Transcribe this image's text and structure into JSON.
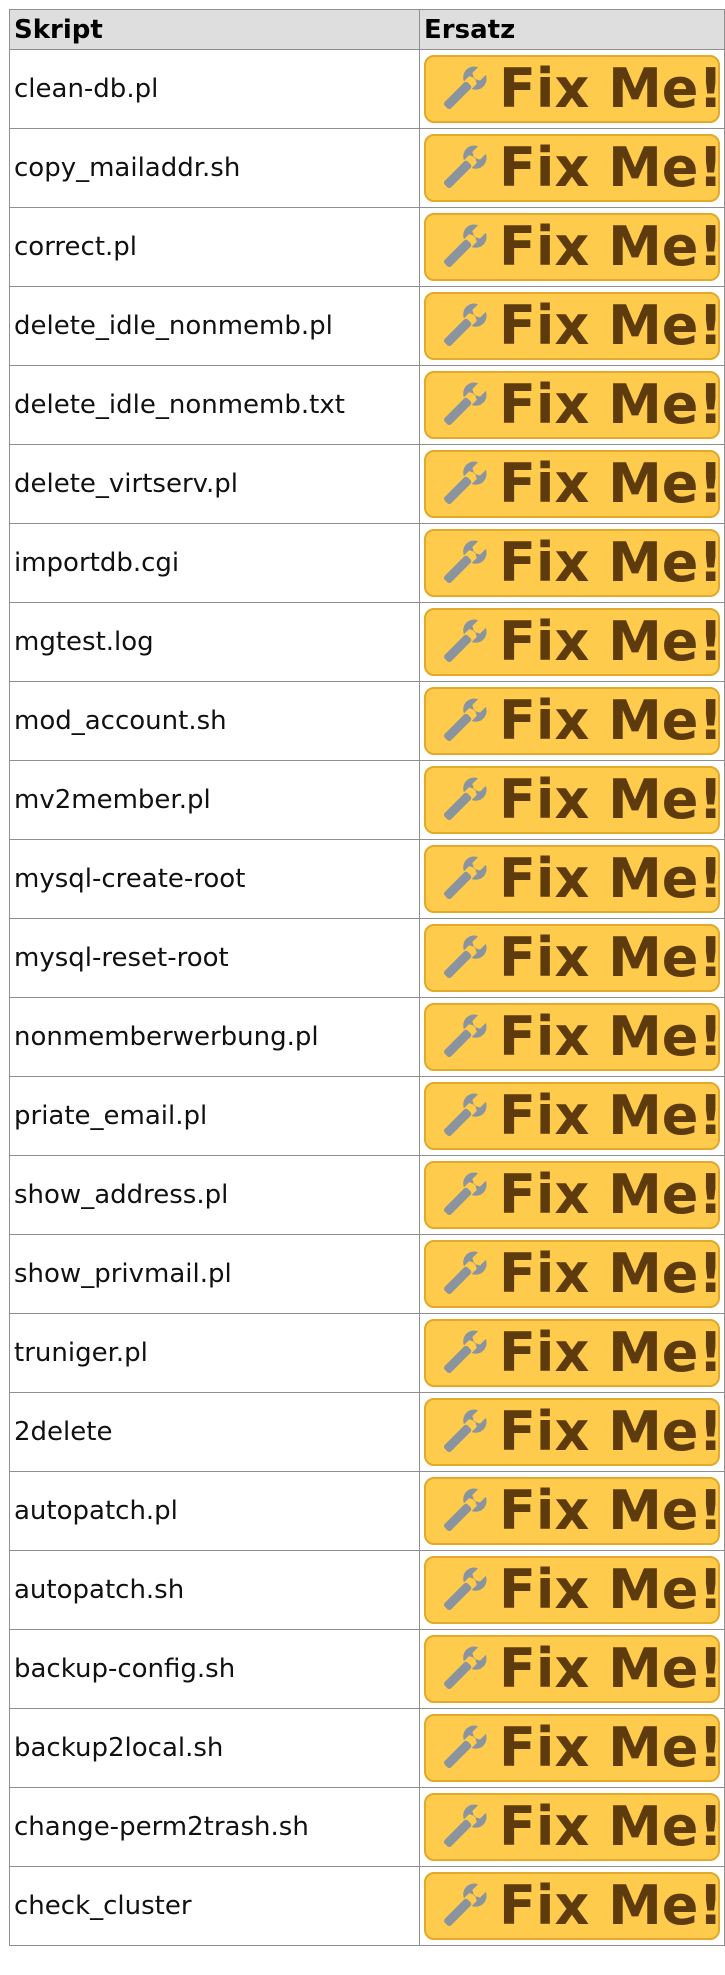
{
  "table": {
    "headers": [
      "Skript",
      "Ersatz"
    ],
    "fixme_label": "Fix Me!",
    "fixme_icon": "wrench-icon",
    "fixme_bg_color": "#fecb4c",
    "fixme_text_color": "#5e3b0d",
    "wrench_color": "#8a949e",
    "rows": [
      "clean-db.pl",
      "copy_mailaddr.sh",
      "correct.pl",
      "delete_idle_nonmemb.pl",
      "delete_idle_nonmemb.txt",
      "delete_virtserv.pl",
      "importdb.cgi",
      "mgtest.log",
      "mod_account.sh",
      "mv2member.pl",
      "mysql-create-root",
      "mysql-reset-root",
      "nonmemberwerbung.pl",
      "priate_email.pl",
      "show_address.pl",
      "show_privmail.pl",
      "truniger.pl",
      "2delete",
      "autopatch.pl",
      "autopatch.sh",
      "backup-config.sh",
      "backup2local.sh",
      "change-perm2trash.sh",
      "check_cluster"
    ]
  }
}
